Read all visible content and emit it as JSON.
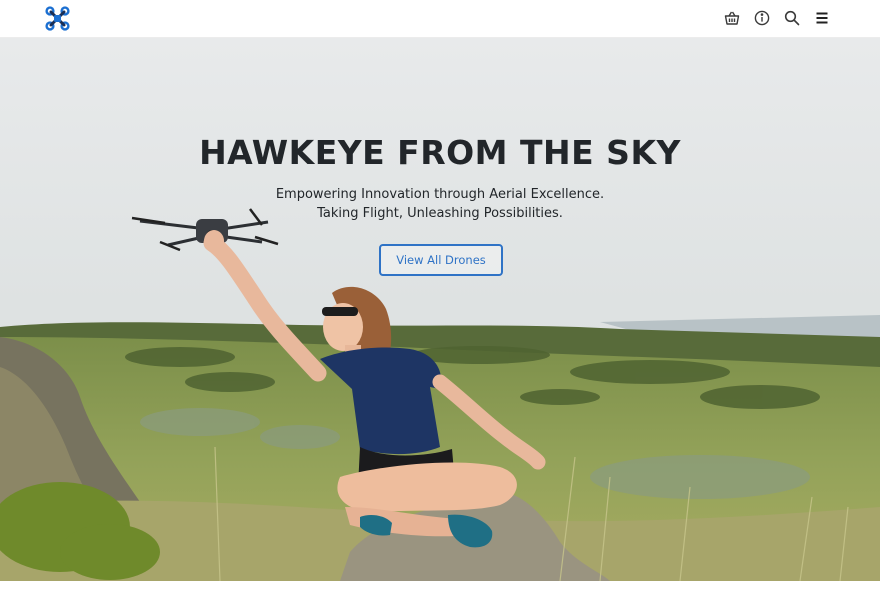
{
  "header": {
    "logo_icon": "drone-logo-icon",
    "icons": [
      "basket-icon",
      "info-icon",
      "search-icon",
      "menu-icon"
    ]
  },
  "hero": {
    "title": "HAWKEYE FROM THE SKY",
    "subtitle_line1": "Empowering Innovation through Aerial Excellence.",
    "subtitle_line2": "Taking Flight, Unleashing Possibilities.",
    "cta_label": "View All Drones"
  },
  "colors": {
    "accent": "#2f73c6",
    "logo_blue": "#1b6fd1",
    "text_dark": "#22262a"
  }
}
